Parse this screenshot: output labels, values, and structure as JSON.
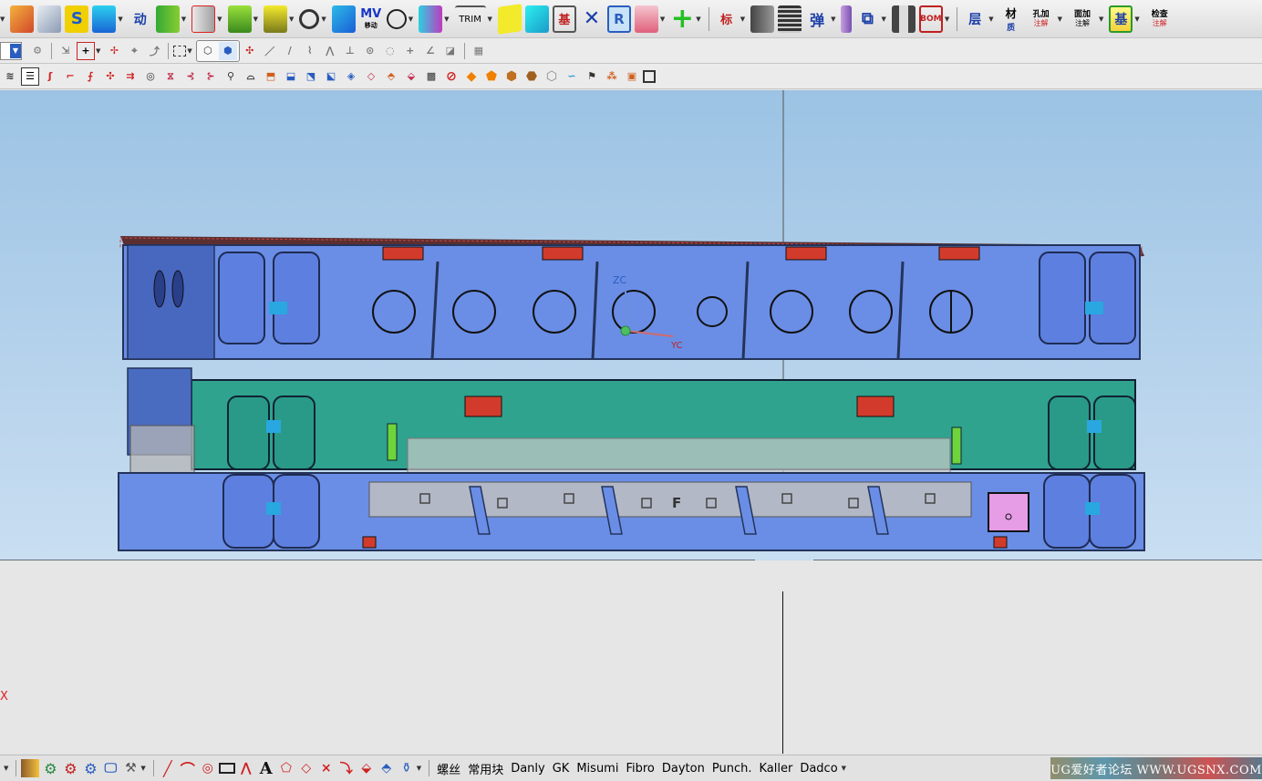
{
  "toolbar1": {
    "tools": [
      {
        "id": "auto",
        "label": "动"
      },
      {
        "id": "move",
        "label": "MV",
        "sub": "移动"
      },
      {
        "id": "trim",
        "label": "TRIM"
      },
      {
        "id": "base",
        "label": "基"
      },
      {
        "id": "r-tool",
        "label": "R"
      },
      {
        "id": "standard",
        "label": "标"
      },
      {
        "id": "spring",
        "label": "弹"
      },
      {
        "id": "bom",
        "label": "BOM"
      },
      {
        "id": "layer",
        "label": "层"
      },
      {
        "id": "material",
        "label": "材",
        "sub": "质"
      },
      {
        "id": "hole-note",
        "label": "孔加",
        "sub": "注解"
      },
      {
        "id": "face-note",
        "label": "面加",
        "sub": "注解"
      },
      {
        "id": "datum",
        "label": "基"
      },
      {
        "id": "check",
        "label": "检查",
        "sub": "注解"
      }
    ]
  },
  "viewport": {
    "axis_labels": {
      "zc": "ZC",
      "yc": "YC"
    },
    "part_letter": "F",
    "origin_marker": "X"
  },
  "statusbar": {
    "libraries": [
      "螺丝",
      "常用块",
      "Danly",
      "GK",
      "Misumi",
      "Fibro",
      "Dayton",
      "Punch.",
      "Kaller",
      "Dadco"
    ],
    "watermark": "UG爱好者论坛 WWW.UGSNX.COM"
  },
  "colors": {
    "plate_blue": "#6a8ee6",
    "plate_green": "#2fa38e",
    "transparent_grey": "#bfbfbf",
    "red_block": "#d23b2b",
    "pink_block": "#e79ce6"
  }
}
